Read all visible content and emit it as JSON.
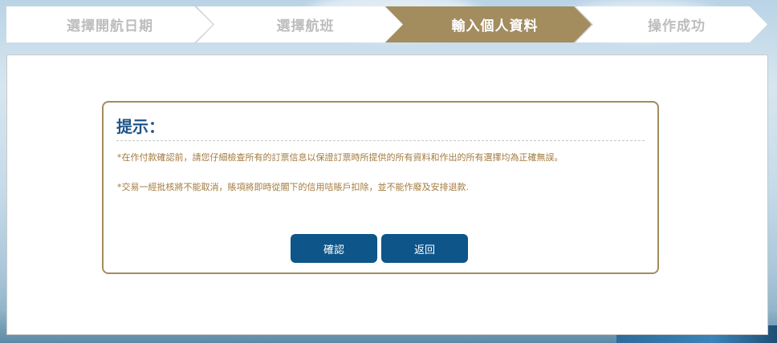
{
  "steps": [
    {
      "label": "選擇開航日期",
      "active": false
    },
    {
      "label": "選擇航班",
      "active": false
    },
    {
      "label": "輸入個人資料",
      "active": true
    },
    {
      "label": "操作成功",
      "active": false
    }
  ],
  "notice": {
    "title": "提示：",
    "line1": "*在作付款確認前，請您仔細檢查所有的訂票信息以保證訂票時所提供的所有資料和作出的所有選擇均為正確無誤。",
    "line2": "*交易一經批核將不能取消，賬項將即時從閣下的信用咭賬戶扣除，並不能作廢及安排退款."
  },
  "buttons": {
    "confirm": "確認",
    "back": "返回"
  },
  "colors": {
    "active_step": "#a38c5e",
    "button": "#0e5589",
    "title": "#1f5588",
    "notice_text": "#a37a3d"
  }
}
